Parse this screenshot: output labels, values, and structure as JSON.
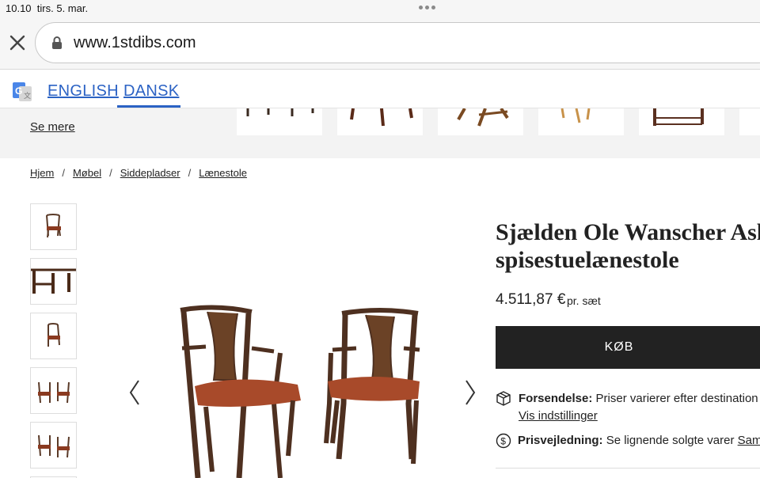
{
  "status_bar": {
    "time": "10.10",
    "date": "tirs. 5. mar."
  },
  "browser": {
    "url": "www.1stdibs.com"
  },
  "translate": {
    "languages": [
      "ENGLISH",
      "DANSK"
    ],
    "active": "DANSK"
  },
  "related": {
    "see_more": "Se mere"
  },
  "breadcrumb": [
    "Hjem",
    "Møbel",
    "Siddepladser",
    "Lænestole"
  ],
  "product": {
    "title_line1": "Sjælden Ole Wanscher Ask",
    "title_line2": "spisestuelænestole",
    "price": "4.511,87 €",
    "price_unit": "pr. sæt",
    "buy_label": "KØB",
    "shipping_label": "Forsendelse:",
    "shipping_text": "Priser varierer efter destination og",
    "shipping_link": "Vis indstillinger",
    "price_guide_label": "Prisvejledning:",
    "price_guide_text": "Se lignende solgte varer",
    "price_guide_link": "Samme"
  },
  "icons": [
    "close-icon",
    "lock-icon",
    "google-translate-icon",
    "chevron-left-icon",
    "chevron-right-icon",
    "package-icon",
    "dollar-icon"
  ]
}
